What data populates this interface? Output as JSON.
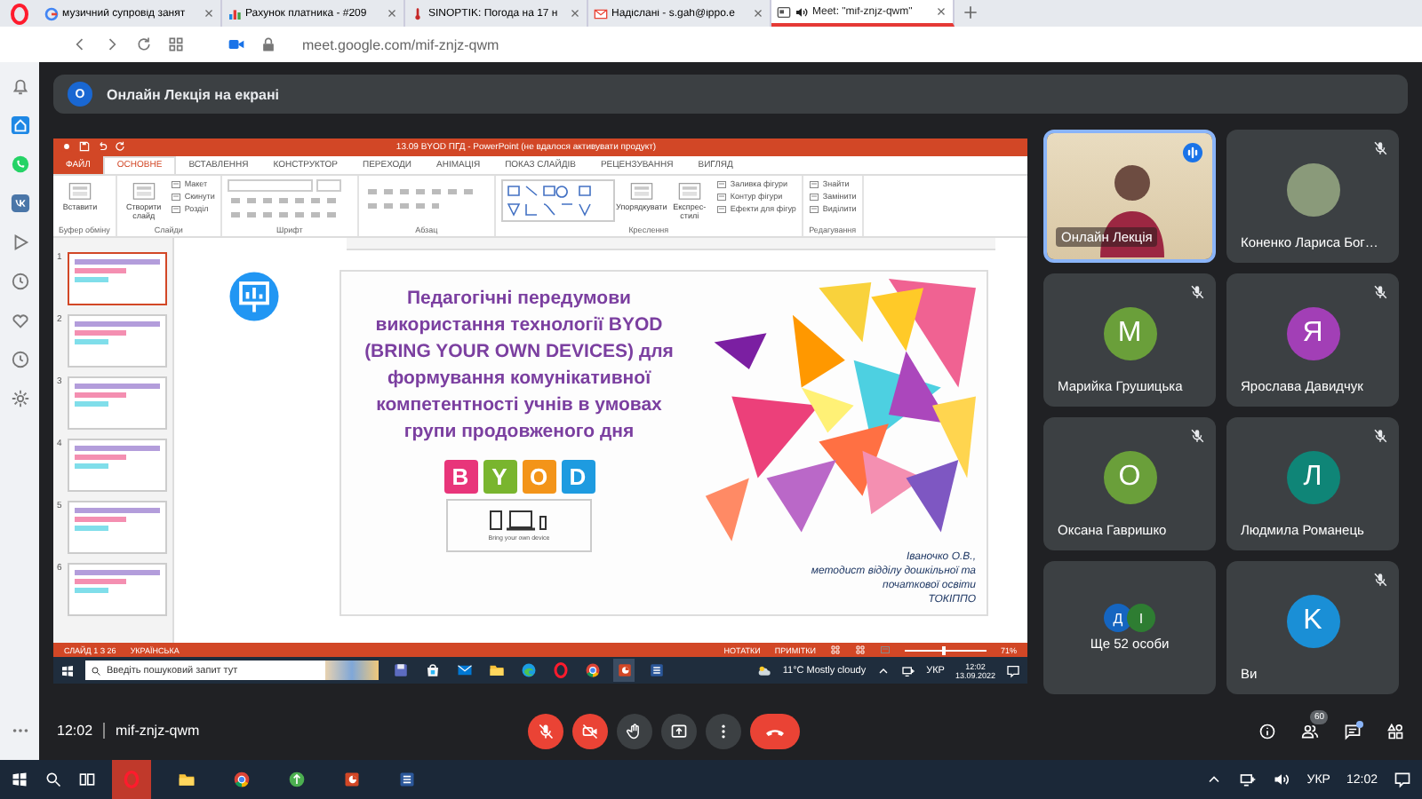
{
  "browser": {
    "tabs": [
      {
        "title": "музичний супровід занят",
        "kind": "search",
        "selected": false
      },
      {
        "title": "Рахунок платника - #209",
        "kind": "chart",
        "selected": false
      },
      {
        "title": "SINOPTIK: Погода на 17 н",
        "kind": "thermometer",
        "selected": false
      },
      {
        "title": "Надіслані - s.gah@ippo.e",
        "kind": "mail",
        "selected": false
      },
      {
        "title": "Meet: \"mif-znjz-qwm\"",
        "kind": "meeting",
        "selected": true
      }
    ],
    "address": "meet.google.com/mif-znjz-qwm"
  },
  "banner": {
    "avatar": "О",
    "text": "Онлайн Лекція на екрані"
  },
  "powerpoint": {
    "title": "13.09 BYOD ПГД - PowerPoint (не вдалося активувати продукт)",
    "tabs": [
      {
        "label": "ФАЙЛ",
        "kind": "file",
        "selected": false
      },
      {
        "label": "ОСНОВНЕ",
        "kind": "tab",
        "selected": true
      },
      {
        "label": "ВСТАВЛЕННЯ",
        "kind": "tab",
        "selected": false
      },
      {
        "label": "КОНСТРУКТОР",
        "kind": "tab",
        "selected": false
      },
      {
        "label": "ПЕРЕХОДИ",
        "kind": "tab",
        "selected": false
      },
      {
        "label": "АНІМАЦІЯ",
        "kind": "tab",
        "selected": false
      },
      {
        "label": "ПОКАЗ СЛАЙДІВ",
        "kind": "tab",
        "selected": false
      },
      {
        "label": "РЕЦЕНЗУВАННЯ",
        "kind": "tab",
        "selected": false
      },
      {
        "label": "ВИГЛЯД",
        "kind": "tab",
        "selected": false
      }
    ],
    "ribbon_groups": [
      {
        "label": "Буфер обміну",
        "kind": "commands",
        "buttons": [
          {
            "label": "Вставити",
            "kind": "large"
          }
        ]
      },
      {
        "label": "Слайди",
        "kind": "commands",
        "buttons": [
          {
            "label": "Створити слайд",
            "kind": "large"
          },
          {
            "label": "Макет",
            "kind": "small"
          },
          {
            "label": "Скинути",
            "kind": "small"
          },
          {
            "label": "Розділ",
            "kind": "small"
          }
        ]
      },
      {
        "label": "Шрифт",
        "kind": "font"
      },
      {
        "label": "Абзац",
        "kind": "paragraph"
      },
      {
        "label": "Креслення",
        "kind": "drawing",
        "buttons": [
          {
            "label": "Упорядкувати",
            "kind": "large"
          },
          {
            "label": "Експрес-стилі",
            "kind": "large"
          },
          {
            "label": "Заливка фігури",
            "kind": "small"
          },
          {
            "label": "Контур фігури",
            "kind": "small"
          },
          {
            "label": "Ефекти для фігур",
            "kind": "small"
          }
        ]
      },
      {
        "label": "Редагування",
        "kind": "commands",
        "buttons": [
          {
            "label": "Знайти",
            "kind": "small"
          },
          {
            "label": "Замінити",
            "kind": "small"
          },
          {
            "label": "Виділити",
            "kind": "small"
          }
        ]
      }
    ],
    "thumbnails": [
      {
        "number": "1",
        "selected": true
      },
      {
        "number": "2",
        "selected": false
      },
      {
        "number": "3",
        "selected": false
      },
      {
        "number": "4",
        "selected": false
      },
      {
        "number": "5",
        "selected": false
      },
      {
        "number": "6",
        "selected": false
      }
    ],
    "slide": {
      "title_lines": [
        "Педагогічні передумови",
        "використання технології BYOD",
        "(BRING YOUR OWN DEVICES) для",
        "формування комунікативної",
        "компетентності учнів в умовах",
        "групи продовженого дня"
      ],
      "logo_letters": [
        {
          "letter": "B",
          "color": "#e8357a"
        },
        {
          "letter": "Y",
          "color": "#79b52e"
        },
        {
          "letter": "O",
          "color": "#f39419"
        },
        {
          "letter": "D",
          "color": "#1e9be0"
        }
      ],
      "device_caption": "Bring your own device",
      "author_lines": [
        "Іваночко О.В.,",
        "методист відділу дошкільної та",
        "початкової освіти",
        "ТОКІППО"
      ]
    },
    "status_bar": {
      "slide": "СЛАЙД 1 З 26",
      "language": "УКРАЇНСЬКА",
      "notes": "НОТАТКИ",
      "comments": "ПРИМІТКИ",
      "zoom": "71%",
      "level": 0.45
    },
    "taskbar": {
      "search_placeholder": "Введіть пошуковий запит тут",
      "apps": [
        {
          "kind": "disk",
          "selected": false
        },
        {
          "kind": "store",
          "selected": false
        },
        {
          "kind": "mail",
          "selected": false
        },
        {
          "kind": "folder",
          "selected": false
        },
        {
          "kind": "edge",
          "selected": false
        },
        {
          "kind": "opera",
          "selected": false
        },
        {
          "kind": "chrome",
          "selected": false
        },
        {
          "kind": "powerpoint",
          "selected": true
        },
        {
          "kind": "word",
          "selected": false
        }
      ],
      "weather": "11°C Mostly cloudy",
      "language": "УКР",
      "time": "12:02",
      "date": "13.09.2022"
    }
  },
  "participants": [
    {
      "name": "Онлайн Лекція",
      "kind": "video",
      "speaking": true,
      "muted": false
    },
    {
      "name": "Коненко Лариса Бог…",
      "kind": "photo",
      "speaking": false,
      "muted": true
    },
    {
      "name": "Марийка Грушицька",
      "kind": "letter",
      "letter": "М",
      "color": "#6a9f3a",
      "speaking": false,
      "muted": true
    },
    {
      "name": "Ярослава Давидчук",
      "kind": "letter",
      "letter": "Я",
      "color": "#a23fb6",
      "speaking": false,
      "muted": true
    },
    {
      "name": "Оксана Гавришко",
      "kind": "letter",
      "letter": "О",
      "color": "#6a9f3a",
      "speaking": false,
      "muted": true
    },
    {
      "name": "Людмила Романець",
      "kind": "letter",
      "letter": "Л",
      "color": "#0f8577",
      "speaking": false,
      "muted": true
    },
    {
      "name": "Ще 52 особи",
      "kind": "group",
      "letters": [
        {
          "letter": "Д",
          "color": "#1565c0"
        },
        {
          "letter": "І",
          "color": "#2e7d32"
        }
      ],
      "speaking": false,
      "muted": false
    },
    {
      "name": "Ви",
      "kind": "letter",
      "letter": "K",
      "color": "#1a8fd6",
      "speaking": false,
      "muted": true
    }
  ],
  "meeting_bar": {
    "time": "12:02",
    "code": "mif-znjz-qwm",
    "mic_on": false,
    "camera_on": false,
    "people_count": "60",
    "chat_unread": true
  },
  "taskbar": {
    "apps": [
      {
        "kind": "opera",
        "selected": true
      },
      {
        "kind": "folder",
        "selected": false
      },
      {
        "kind": "chrome",
        "selected": false
      },
      {
        "kind": "green",
        "selected": false
      },
      {
        "kind": "powerpoint",
        "selected": false
      },
      {
        "kind": "word",
        "selected": false
      }
    ],
    "language": "УКР",
    "time": "12:02"
  }
}
